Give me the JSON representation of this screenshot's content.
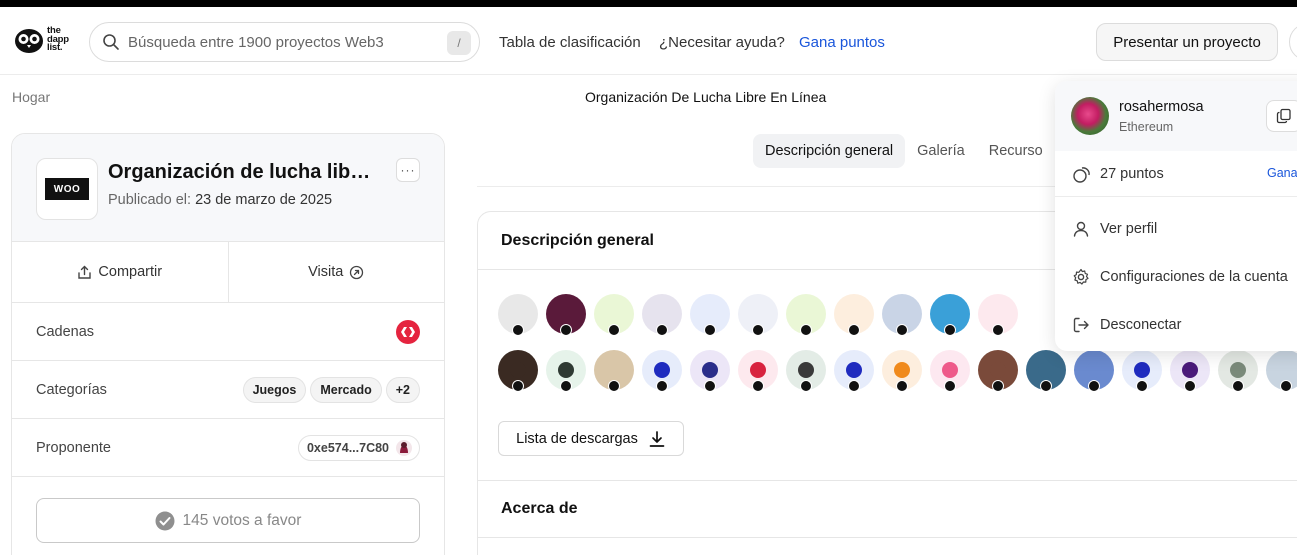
{
  "header": {
    "logo_lines": [
      "the",
      "dapp",
      "list."
    ],
    "search_placeholder": "Búsqueda entre 1900 proyectos Web3",
    "search_shortcut": "/",
    "nav": [
      {
        "label": "Tabla de clasificación"
      },
      {
        "label": "¿Necesitar ayuda?"
      },
      {
        "label": "Gana puntos"
      }
    ],
    "present_button": "Presentar un proyecto"
  },
  "breadcrumb": "Hogar",
  "page_title": "Organización De Lucha Libre En Línea",
  "project": {
    "name": "Organización de lucha lib…",
    "logo_text": "WOO",
    "published_label": "Publicado el:",
    "published_date": "23 de marzo de 2025",
    "more_label": "···",
    "share_label": "Compartir",
    "visit_label": "Visita",
    "rows": {
      "chains_label": "Cadenas",
      "categories_label": "Categorías",
      "categories": [
        "Juegos",
        "Mercado",
        "+2"
      ],
      "proposer_label": "Proponente",
      "proposer_address": "0xe574...7C80"
    },
    "votes_label": "145 votos a favor"
  },
  "tabs": [
    {
      "label": "Descripción general",
      "active": true
    },
    {
      "label": "Galería",
      "active": false
    },
    {
      "label": "Recurso",
      "active": false
    }
  ],
  "overview": {
    "heading": "Descripción general",
    "download_label": "Lista de descargas",
    "about_heading": "Acerca de",
    "dot_colors_row1": [
      "#e8e8e8",
      "#5a1a3a",
      "#eaf7d6",
      "#e6e3ee",
      "#e6ecfb",
      "#eef0f7",
      "#eaf7d6",
      "#fdeede",
      "#c9d4e6",
      "#3aa0d8",
      "#fde9ee",
      "#dfe8dc"
    ],
    "dot_colors_row2": [
      "#3a2a22",
      "#e6f3ea",
      "#d9c6a8",
      "#e6ecfb",
      "#ece6f7",
      "#fde9ee",
      "#e3ece6",
      "#e6ecfb",
      "#fdeede",
      "#fde8f0",
      "#7a4a3a",
      "#3a6a8a",
      "#6a8acf",
      "#e6ecfb",
      "#ece6f7",
      "#e3e8e3",
      "#c8d4e0"
    ],
    "glyph_colors_row2": [
      "#3a2a22",
      "#2f3a33",
      "#d9c6a8",
      "#1f2bbf",
      "#2a2d8a",
      "#d8233f",
      "#3a3a3a",
      "#1f2bbf",
      "#f08a1c",
      "#ee5a8a",
      "#7a4a3a",
      "#3a6a8a",
      "#6a8acf",
      "#1f2bbf",
      "#4a1a7a",
      "#7a8a7a",
      "#c8d4e0"
    ]
  },
  "user_menu": {
    "username": "rosahermosa",
    "chain": "Ethereum",
    "points": "27 puntos",
    "earn_label": "Gana",
    "items": [
      {
        "label": "Ver perfil"
      },
      {
        "label": "Configuraciones de la cuenta"
      },
      {
        "label": "Desconectar"
      }
    ]
  },
  "colors": {
    "accent_blue": "#1a56db",
    "chain_red": "#e5243f"
  }
}
